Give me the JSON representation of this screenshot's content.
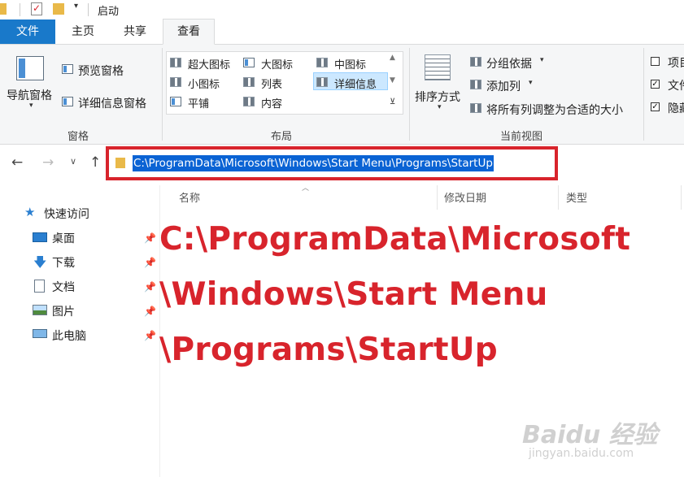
{
  "window": {
    "title": "启动"
  },
  "ribbon_tabs": [
    {
      "label": "文件"
    },
    {
      "label": "主页"
    },
    {
      "label": "共享"
    },
    {
      "label": "查看"
    }
  ],
  "panes_group": {
    "nav_pane": "导航窗格",
    "preview_pane": "预览窗格",
    "details_pane": "详细信息窗格",
    "label": "窗格"
  },
  "layout_group": {
    "items": [
      "超大图标",
      "大图标",
      "中图标",
      "小图标",
      "列表",
      "详细信息",
      "平铺",
      "内容"
    ],
    "label": "布局"
  },
  "current_view_group": {
    "sort_by": "排序方式",
    "group_by": "分组依据",
    "add_column": "添加列",
    "fit_columns": "将所有列调整为合适的大小",
    "label": "当前视图"
  },
  "show_hide_group": {
    "items": [
      "项目",
      "文件",
      "隐藏"
    ]
  },
  "address_bar": {
    "path": "C:\\ProgramData\\Microsoft\\Windows\\Start Menu\\Programs\\StartUp"
  },
  "nav_pane_items": [
    {
      "label": "快速访问"
    },
    {
      "label": "桌面"
    },
    {
      "label": "下载"
    },
    {
      "label": "文档"
    },
    {
      "label": "图片"
    },
    {
      "label": "此电脑"
    }
  ],
  "columns": [
    {
      "label": "名称"
    },
    {
      "label": "修改日期"
    },
    {
      "label": "类型"
    }
  ],
  "annotation": {
    "line1": "C:\\ProgramData\\Microsoft",
    "line2": "\\Windows\\Start Menu",
    "line3": "\\Programs\\StartUp"
  },
  "watermark": {
    "brand": "Baidu 经验",
    "url": "jingyan.baidu.com"
  },
  "colors": {
    "accent": "#1979ca",
    "highlight": "#d8242c",
    "selection": "#0a63d4"
  }
}
